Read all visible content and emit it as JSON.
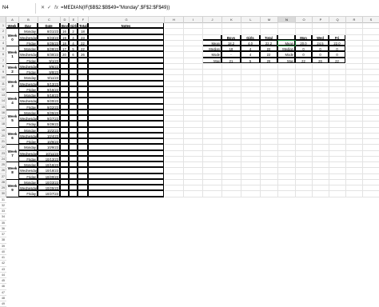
{
  "formula_bar": {
    "name_box": "N4",
    "cancel_icon": "cancel-icon",
    "confirm_icon": "confirm-icon",
    "fx_label": "fx",
    "formula": "=MEDIAN(IF($B$2:$B$49=\"Monday\",$F$2:$F$49))"
  },
  "columns": [
    "A",
    "B",
    "C",
    "D",
    "E",
    "F",
    "G",
    "H",
    "I",
    "J",
    "K",
    "L",
    "M",
    "N",
    "O",
    "P",
    "Q",
    "R",
    "S",
    "T"
  ],
  "selected_column": "N",
  "row_numbers": [
    "1",
    "2",
    "3",
    "4",
    "5",
    "6",
    "7",
    "8",
    "9",
    "10",
    "11",
    "12",
    "13",
    "14",
    "15",
    "16",
    "17",
    "18",
    "19",
    "20",
    "21",
    "22",
    "23",
    "24",
    "25",
    "26",
    "27",
    "28",
    "29",
    "30",
    "31",
    "32",
    "33",
    "34",
    "35",
    "36",
    "37",
    "38",
    "39",
    "40",
    "41",
    "42",
    "43",
    "44",
    "45",
    "46",
    "47",
    "48",
    "49"
  ],
  "table": {
    "headers": {
      "week": "Week",
      "day": "Day",
      "date": "Date",
      "boys": "Boys",
      "girls": "Girls",
      "total": "Total",
      "notes": "Notes"
    },
    "weeks": [
      {
        "label": "Week 0",
        "rows": [
          {
            "day": "Monday",
            "date": "8/21/23",
            "boys": "16",
            "girls": "2",
            "total": "18"
          },
          {
            "day": "Wednesday",
            "date": "8/23/23",
            "boys": "19",
            "girls": "4",
            "total": "23"
          },
          {
            "day": "Friday",
            "date": "8/25/23",
            "boys": "18",
            "girls": "4",
            "total": "22"
          }
        ]
      },
      {
        "label": "Week 1",
        "rows": [
          {
            "day": "Monday",
            "date": "8/28/23",
            "boys": "17",
            "girls": "5",
            "total": "22"
          },
          {
            "day": "Wednesday",
            "date": "8/30/23",
            "boys": "20",
            "girls": "6",
            "total": "26"
          },
          {
            "day": "Friday",
            "date": "9/1/23",
            "boys": "",
            "girls": "",
            "total": ""
          }
        ]
      },
      {
        "label": "Week 2",
        "rows": [
          {
            "day": "Wednesday",
            "date": "9/6/23",
            "boys": "",
            "girls": "",
            "total": ""
          },
          {
            "day": "Friday",
            "date": "9/8/23",
            "boys": "",
            "girls": "",
            "total": ""
          }
        ]
      },
      {
        "label": "Week 3",
        "rows": [
          {
            "day": "Monday",
            "date": "9/11/23",
            "boys": "",
            "girls": "",
            "total": ""
          },
          {
            "day": "Wednesday",
            "date": "9/13/23",
            "boys": "",
            "girls": "",
            "total": ""
          },
          {
            "day": "Friday",
            "date": "9/15/23",
            "boys": "",
            "girls": "",
            "total": ""
          }
        ]
      },
      {
        "label": "Week 4",
        "rows": [
          {
            "day": "Monday",
            "date": "9/18/23",
            "boys": "",
            "girls": "",
            "total": ""
          },
          {
            "day": "Wednesday",
            "date": "9/20/23",
            "boys": "",
            "girls": "",
            "total": ""
          },
          {
            "day": "Friday",
            "date": "9/22/23",
            "boys": "",
            "girls": "",
            "total": ""
          }
        ]
      },
      {
        "label": "Week 5",
        "rows": [
          {
            "day": "Monday",
            "date": "9/25/23",
            "boys": "",
            "girls": "",
            "total": ""
          },
          {
            "day": "Wednesday",
            "date": "9/27/23",
            "boys": "",
            "girls": "",
            "total": ""
          },
          {
            "day": "Friday",
            "date": "9/29/23",
            "boys": "",
            "girls": "",
            "total": ""
          }
        ]
      },
      {
        "label": "Week 6",
        "rows": [
          {
            "day": "Monday",
            "date": "10/2/23",
            "boys": "",
            "girls": "",
            "total": ""
          },
          {
            "day": "Wednesday",
            "date": "10/4/23",
            "boys": "",
            "girls": "",
            "total": ""
          },
          {
            "day": "Friday",
            "date": "10/6/23",
            "boys": "",
            "girls": "",
            "total": ""
          }
        ]
      },
      {
        "label": "Week 7",
        "rows": [
          {
            "day": "Monday",
            "date": "10/9/23",
            "boys": "",
            "girls": "",
            "total": ""
          },
          {
            "day": "Wednesday",
            "date": "10/11/23",
            "boys": "",
            "girls": "",
            "total": ""
          },
          {
            "day": "Friday",
            "date": "10/13/23",
            "boys": "",
            "girls": "",
            "total": ""
          }
        ]
      },
      {
        "label": "Week 8",
        "rows": [
          {
            "day": "Monday",
            "date": "10/16/23",
            "boys": "",
            "girls": "",
            "total": ""
          },
          {
            "day": "Wednesday",
            "date": "10/18/23",
            "boys": "",
            "girls": "",
            "total": ""
          },
          {
            "day": "Friday",
            "date": "10/20/23",
            "boys": "",
            "girls": "",
            "total": ""
          }
        ]
      },
      {
        "label": "Week 9",
        "rows": [
          {
            "day": "Monday",
            "date": "10/23/23",
            "boys": "",
            "girls": "",
            "total": ""
          },
          {
            "day": "Wednesday",
            "date": "10/25/23",
            "boys": "",
            "girls": "",
            "total": ""
          },
          {
            "day": "Friday",
            "date": "10/27/23",
            "boys": "",
            "girls": "",
            "total": ""
          }
        ]
      },
      {
        "label": "Week 10",
        "rows": [
          {
            "day": "Monday",
            "date": "10/30/23",
            "boys": "",
            "girls": "",
            "total": ""
          },
          {
            "day": "Wednesday",
            "date": "11/1/23",
            "boys": "",
            "girls": "",
            "total": ""
          },
          {
            "day": "Friday",
            "date": "11/3/23",
            "boys": "",
            "girls": "",
            "total": ""
          }
        ]
      },
      {
        "label": "Week 11",
        "rows": [
          {
            "day": "Monday",
            "date": "11/6/23",
            "boys": "",
            "girls": "",
            "total": ""
          },
          {
            "day": "Wednesday",
            "date": "11/8/23",
            "boys": "",
            "girls": "",
            "total": ""
          },
          {
            "day": "Friday",
            "date": "11/10/23",
            "boys": "",
            "girls": "",
            "total": ""
          }
        ]
      }
    ]
  },
  "stats": {
    "headers": [
      "",
      "Boys",
      "Girls",
      "Total",
      "",
      "Mon",
      "Wed",
      "Fri"
    ],
    "rows": [
      [
        "Mean",
        "18.2",
        "4.0",
        "22.2",
        "Mean",
        "20.0",
        "24.5",
        "22.0"
      ],
      [
        "Median",
        "18",
        "4",
        "22",
        "Median",
        "0",
        "0",
        "0"
      ],
      [
        "Mode",
        "-",
        "4",
        "22",
        "Mode",
        "0",
        "0",
        "0"
      ],
      [
        "Max",
        "21",
        "5",
        "26",
        "Max",
        "22",
        "26",
        "22"
      ]
    ]
  }
}
